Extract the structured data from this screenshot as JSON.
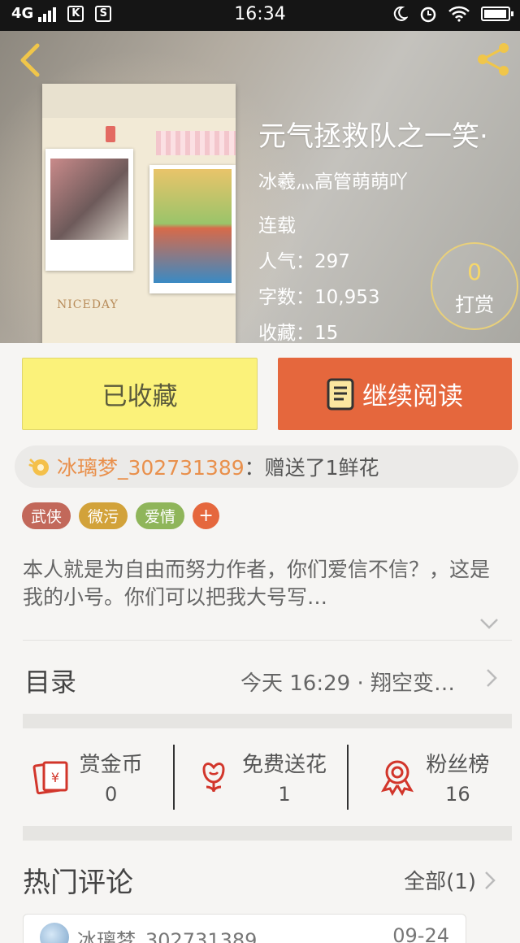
{
  "statusbar": {
    "network": "4G",
    "app1": "K",
    "app2": "S",
    "time": "16:34"
  },
  "book": {
    "title": "元气拯救队之一笑·",
    "author": "冰羲灬高管萌萌吖",
    "status": "连载",
    "popularity": "人气：297",
    "words": "字数：10,953",
    "favorites": "收藏：15",
    "cover_label": "NICEDAY"
  },
  "reward": {
    "count": "0",
    "label": "打赏"
  },
  "actions": {
    "favorited_label": "已收藏",
    "continue_label": "继续阅读"
  },
  "gift": {
    "user": "冰璃梦_302731389",
    "message": "：赠送了1鲜花"
  },
  "tags": [
    {
      "label": "武侠",
      "color": "#c2685a"
    },
    {
      "label": "微污",
      "color": "#d2a23a"
    },
    {
      "label": "爱情",
      "color": "#8fb55a"
    }
  ],
  "tag_add": "+",
  "intro": "本人就是为自由而努力作者，你们爱信不信？，这是我的小号。你们可以把我大号写…",
  "catalog": {
    "label": "目录",
    "update": "今天 16:29 · 翔空变…"
  },
  "stats": [
    {
      "label": "赏金币",
      "value": "0",
      "icon": "red-envelope-icon"
    },
    {
      "label": "免费送花",
      "value": "1",
      "icon": "flower-icon"
    },
    {
      "label": "粉丝榜",
      "value": "16",
      "icon": "medal-icon"
    }
  ],
  "comments": {
    "heading": "热门评论",
    "all_label": "全部(1)",
    "first": {
      "user": "冰璃梦_302731389",
      "date": "09-24"
    }
  },
  "colors": {
    "accent": "#e5673d",
    "fav": "#fbf27a",
    "gift_user": "#e9904c"
  }
}
